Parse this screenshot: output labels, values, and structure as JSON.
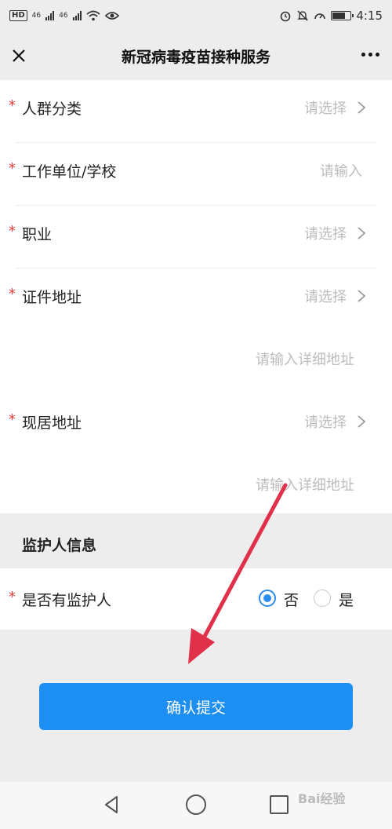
{
  "status_bar": {
    "left_chip": "HD",
    "net1": "46",
    "net2": "46",
    "time": "4:15",
    "battery_level": 0.8,
    "icons": [
      "signal-icon",
      "signal-icon",
      "wifi-icon",
      "eye-icon",
      "alarm-icon",
      "mute-icon",
      "speed-icon",
      "battery-icon"
    ]
  },
  "navbar": {
    "title": "新冠病毒疫苗接种服务",
    "close_icon": "close-icon",
    "more_icon": "more-icon"
  },
  "form": {
    "fields": [
      {
        "label": "人群分类",
        "placeholder": "请选择",
        "required": true,
        "arrow": true
      },
      {
        "label": "工作单位/学校",
        "placeholder": "请输入",
        "required": true,
        "arrow": false
      },
      {
        "label": "职业",
        "placeholder": "请选择",
        "required": true,
        "arrow": true
      },
      {
        "label": "证件地址",
        "placeholder": "请选择",
        "required": true,
        "arrow": true
      }
    ],
    "id_address_detail_placeholder": "请输入详细地址",
    "current_address": {
      "label": "现居地址",
      "placeholder": "请选择",
      "required": true,
      "arrow": true
    },
    "current_address_detail_placeholder": "请输入详细地址"
  },
  "guardian_section": {
    "title": "监护人信息",
    "question": "是否有监护人",
    "options": [
      {
        "label": "否",
        "selected": true
      },
      {
        "label": "是",
        "selected": false
      }
    ]
  },
  "submit_label": "确认提交",
  "required_mark": "*",
  "watermark": "Bai经验",
  "accent_color": "#1d8ff2",
  "annotation_color": "#e0304a"
}
